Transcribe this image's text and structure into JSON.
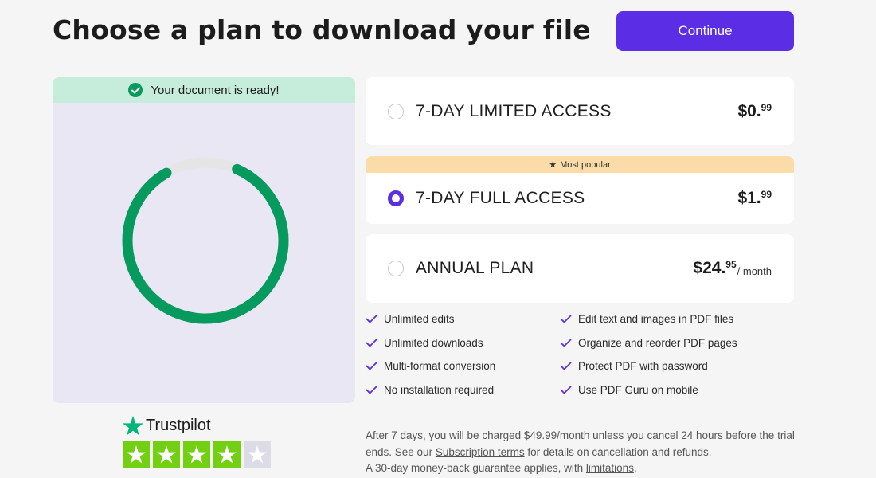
{
  "header": {
    "title": "Choose a plan to download your file",
    "continue_label": "Continue"
  },
  "preview": {
    "ready_text": "Your document is ready!",
    "progress_fraction": 0.85
  },
  "plans": [
    {
      "name": "7-DAY LIMITED ACCESS",
      "price_main": "$0.",
      "price_cents": "99",
      "period": "",
      "selected": false
    },
    {
      "name": "7-DAY FULL ACCESS",
      "price_main": "$1.",
      "price_cents": "99",
      "period": "",
      "selected": true,
      "badge": "Most popular"
    },
    {
      "name": "ANNUAL PLAN",
      "price_main": "$24.",
      "price_cents": "95",
      "period": "/ month",
      "selected": false
    }
  ],
  "features": [
    "Unlimited edits",
    "Edit text and images in PDF files",
    "Unlimited downloads",
    "Organize and reorder PDF pages",
    "Multi-format conversion",
    "Protect PDF with password",
    "No installation required",
    "Use PDF Guru on mobile"
  ],
  "trustpilot": {
    "logo_text": "Trustpilot",
    "rating_stars": 4,
    "max_stars": 5
  },
  "terms": {
    "part1": "After 7 days, you will be charged $49.99/month unless you cancel 24 hours before the trial ends. See our ",
    "subscription_link": "Subscription terms",
    "part2": " for details on cancellation and refunds.",
    "part3": "A 30-day money-back guarantee applies, with ",
    "limitations_link": "limitations",
    "part4": "."
  },
  "colors": {
    "accent": "#5b2ee6",
    "success": "#079a5e",
    "ready_bar": "#c6ecdc",
    "preview_bg": "#e9e7f3",
    "popular_banner": "#fbdba7",
    "trustpilot_green": "#00b67a"
  }
}
